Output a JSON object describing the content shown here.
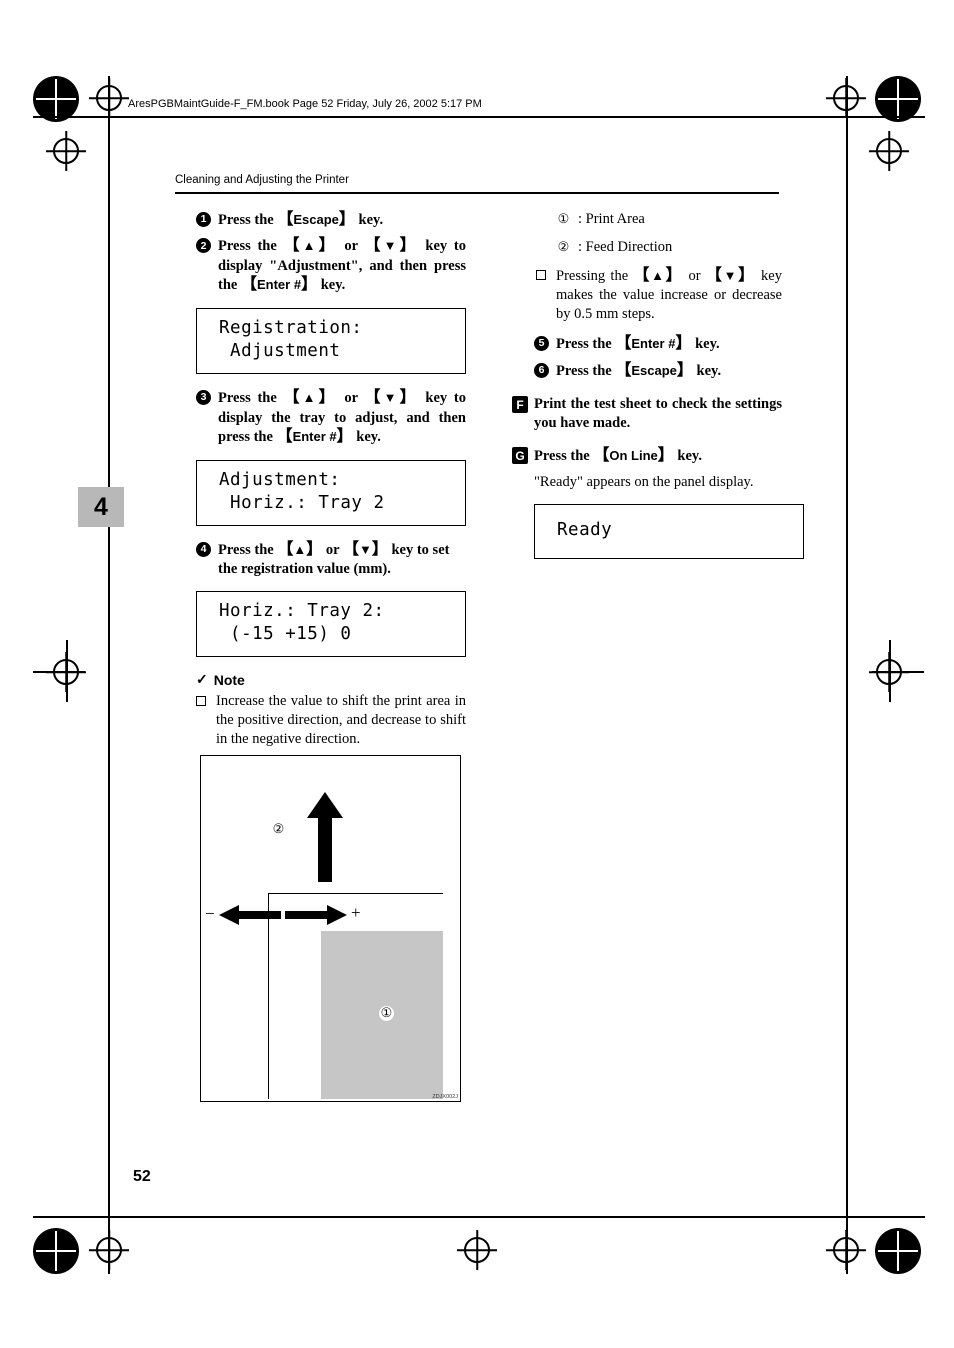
{
  "header": {
    "book_line": "AresPGBMaintGuide-F_FM.book  Page 52  Friday, July 26, 2002  5:17 PM",
    "running_head": "Cleaning and Adjusting the Printer"
  },
  "chapter_tab": "4",
  "page_number": "52",
  "left_column": {
    "steps": [
      {
        "num": "1",
        "shape": "circle",
        "text_html": "Press the <span class=\"kb\">【</span><span class=\"key\">Escape</span><span class=\"kb\">】</span> key."
      },
      {
        "num": "2",
        "shape": "circle",
        "text_html": "Press the <span class=\"kb\">【</span><span class=\"key\">▲</span><span class=\"kb\">】</span> or <span class=\"kb\">【</span><span class=\"key\">▼</span><span class=\"kb\">】</span> key to display \"Adjustment\", and then press the <span class=\"kb\">【</span><span class=\"key\">Enter #</span><span class=\"kb\">】</span> key."
      },
      {
        "num": "3",
        "shape": "circle",
        "text_html": "Press the <span class=\"kb\">【</span><span class=\"key\">▲</span><span class=\"kb\">】</span> or <span class=\"kb\">【</span><span class=\"key\">▼</span><span class=\"kb\">】</span> key to display the tray to adjust, and then press the <span class=\"kb\">【</span><span class=\"key\">Enter #</span><span class=\"kb\">】</span> key."
      },
      {
        "num": "4",
        "shape": "circle",
        "text_html": "Press the <span class=\"kb\">【</span><span class=\"key\">▲</span><span class=\"kb\">】</span> or <span class=\"kb\">【</span><span class=\"key\">▼</span><span class=\"kb\">】</span> key to set the registration value (mm)."
      }
    ],
    "lcd1": [
      "Registration:",
      " Adjustment"
    ],
    "lcd2": [
      "Adjustment:",
      " Horiz.: Tray 2"
    ],
    "lcd3": [
      "Horiz.: Tray 2:",
      " (-15 +15) 0"
    ],
    "note_label": "Note",
    "note_items": [
      "Increase the value to shift the print area in the positive direction, and decrease to shift in the negative direction."
    ]
  },
  "right_column": {
    "legend": [
      {
        "num": "①",
        "text": ": Print Area"
      },
      {
        "num": "②",
        "text": ": Feed Direction"
      }
    ],
    "bullet_html": "Pressing the <span class=\"kb\">【</span><span class=\"key\">▲</span><span class=\"kb\">】</span> or <span class=\"kb\">【</span><span class=\"key\">▼</span><span class=\"kb\">】</span> key makes the value increase or decrease by 0.5 mm steps.",
    "steps": [
      {
        "num": "5",
        "shape": "circle",
        "text_html": "Press the <span class=\"kb\">【</span><span class=\"key\">Enter #</span><span class=\"kb\">】</span> key."
      },
      {
        "num": "6",
        "shape": "circle",
        "text_html": "Press the <span class=\"kb\">【</span><span class=\"key\">Escape</span><span class=\"kb\">】</span> key."
      },
      {
        "num": "F",
        "shape": "square",
        "text_html": "Print the test sheet to check the settings you have made."
      },
      {
        "num": "G",
        "shape": "square",
        "text_html": "Press the <span class=\"kb\">【</span><span class=\"key\">On Line</span><span class=\"kb\">】</span> key."
      }
    ],
    "ready_text": "\"Ready\" appears on the panel display.",
    "lcd_ready": [
      "Ready"
    ]
  },
  "figure": {
    "label_feed": "②",
    "label_print_area": "①",
    "plus": "+",
    "minus": "−",
    "caption": "ZDJX002J"
  }
}
